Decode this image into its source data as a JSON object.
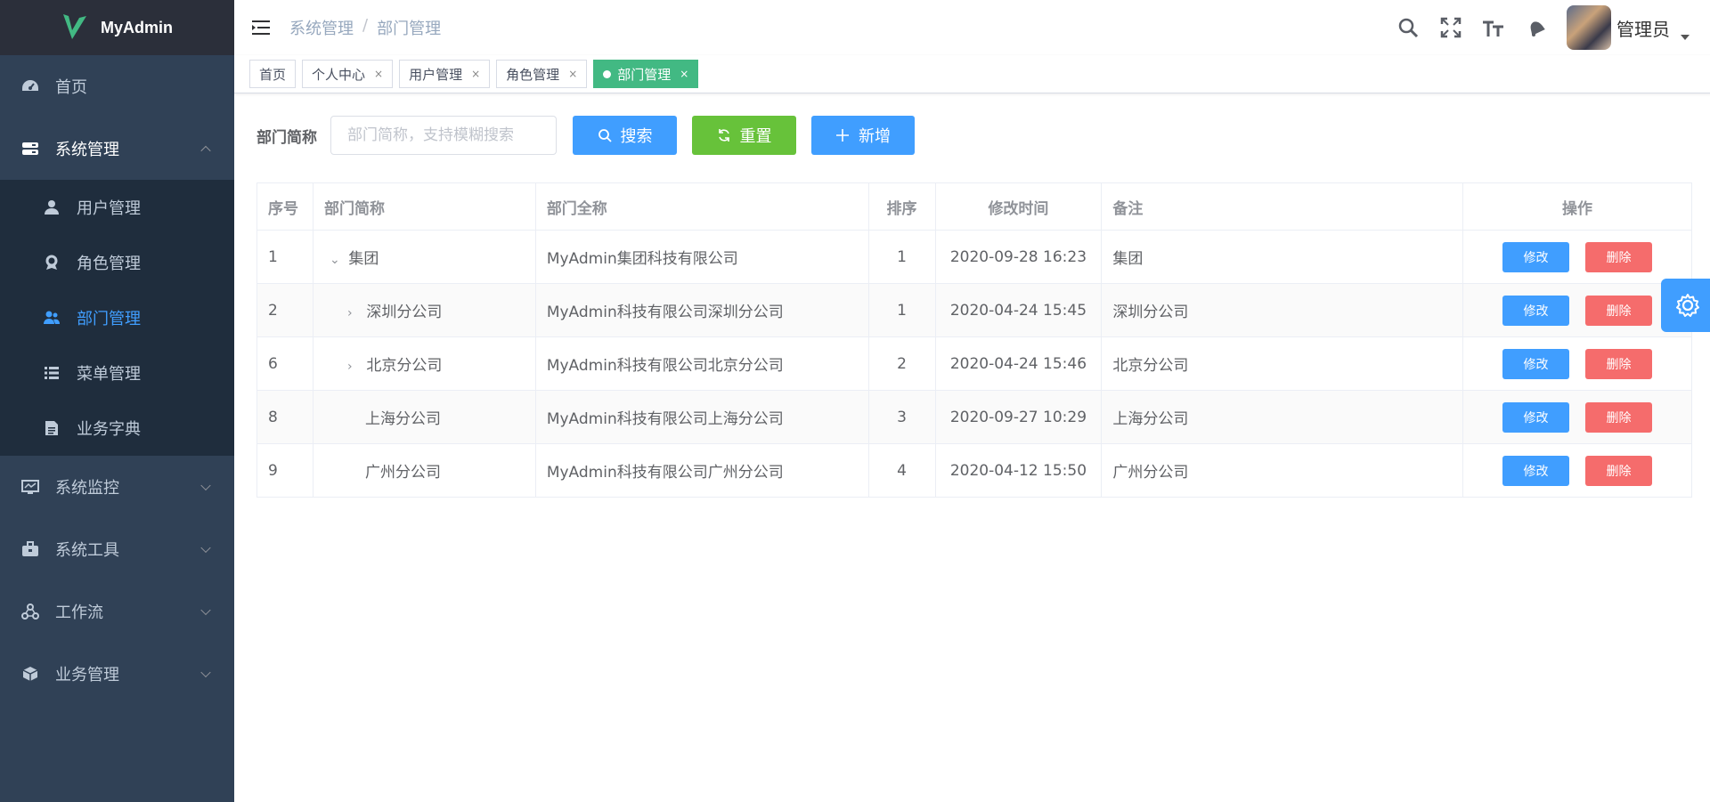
{
  "app": {
    "title": "MyAdmin"
  },
  "sidebar": {
    "items": [
      {
        "label": "首页",
        "icon": "dashboard-icon"
      },
      {
        "label": "系统管理",
        "icon": "system-icon",
        "open": true,
        "children": [
          {
            "label": "用户管理",
            "icon": "user-icon"
          },
          {
            "label": "角色管理",
            "icon": "role-icon"
          },
          {
            "label": "部门管理",
            "icon": "dept-icon",
            "active": true
          },
          {
            "label": "菜单管理",
            "icon": "list-icon"
          },
          {
            "label": "业务字典",
            "icon": "dict-icon"
          }
        ]
      },
      {
        "label": "系统监控",
        "icon": "monitor-icon"
      },
      {
        "label": "系统工具",
        "icon": "toolbox-icon"
      },
      {
        "label": "工作流",
        "icon": "workflow-icon"
      },
      {
        "label": "业务管理",
        "icon": "cube-icon"
      }
    ]
  },
  "navbar": {
    "breadcrumb": [
      "系统管理",
      "部门管理"
    ],
    "user_name": "管理员"
  },
  "tags": [
    {
      "label": "首页",
      "closable": false
    },
    {
      "label": "个人中心",
      "closable": true
    },
    {
      "label": "用户管理",
      "closable": true
    },
    {
      "label": "角色管理",
      "closable": true
    },
    {
      "label": "部门管理",
      "closable": true,
      "active": true
    }
  ],
  "search": {
    "label": "部门简称",
    "placeholder": "部门简称，支持模糊搜索",
    "search_label": "搜索",
    "reset_label": "重置",
    "add_label": "新增"
  },
  "table": {
    "headers": [
      "序号",
      "部门简称",
      "部门全称",
      "排序",
      "修改时间",
      "备注",
      "操作"
    ],
    "rows": [
      {
        "id": "1",
        "short": "集团",
        "full": "MyAdmin集团科技有限公司",
        "order": "1",
        "time": "2020-09-28 16:23",
        "note": "集团",
        "tree": "expanded",
        "level": 0
      },
      {
        "id": "2",
        "short": "深圳分公司",
        "full": "MyAdmin科技有限公司深圳分公司",
        "order": "1",
        "time": "2020-04-24 15:45",
        "note": "深圳分公司",
        "tree": "collapsed",
        "level": 1
      },
      {
        "id": "6",
        "short": "北京分公司",
        "full": "MyAdmin科技有限公司北京分公司",
        "order": "2",
        "time": "2020-04-24 15:46",
        "note": "北京分公司",
        "tree": "collapsed",
        "level": 1
      },
      {
        "id": "8",
        "short": "上海分公司",
        "full": "MyAdmin科技有限公司上海分公司",
        "order": "3",
        "time": "2020-09-27 10:29",
        "note": "上海分公司",
        "tree": "leaf",
        "level": 1
      },
      {
        "id": "9",
        "short": "广州分公司",
        "full": "MyAdmin科技有限公司广州分公司",
        "order": "4",
        "time": "2020-04-12 15:50",
        "note": "广州分公司",
        "tree": "leaf",
        "level": 1
      }
    ],
    "edit_label": "修改",
    "delete_label": "删除"
  },
  "colors": {
    "sidebar_bg": "#304156",
    "submenu_bg": "#1f2d3d",
    "primary": "#409eff",
    "success": "#67c23a",
    "danger": "#f56c6c",
    "tag_active": "#42b983"
  }
}
